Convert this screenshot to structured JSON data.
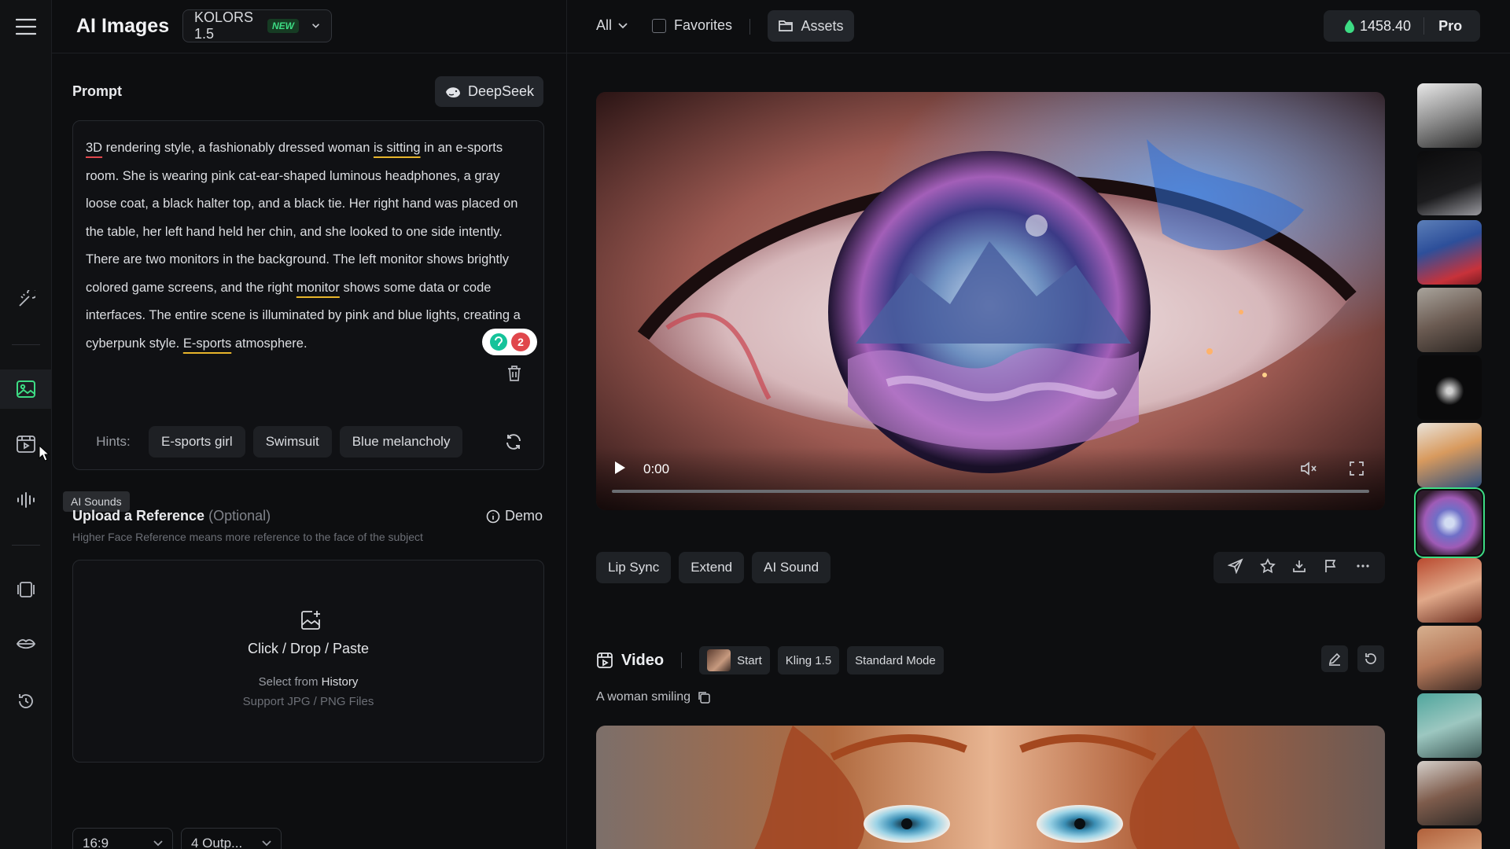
{
  "app": {
    "title": "AI Images",
    "model": "KOLORS 1.5",
    "model_badge": "NEW"
  },
  "sidebar": {
    "tooltip_sounds": "AI Sounds",
    "tooltip_videos_ghost": "AI Videos"
  },
  "topbar": {
    "filter": "All",
    "favorites": "Favorites",
    "assets": "Assets",
    "credits": "1458.40",
    "plan": "Pro"
  },
  "prompt": {
    "label": "Prompt",
    "deepseek": "DeepSeek",
    "text_parts": {
      "p1": "3D",
      "p2": " rendering style, a fashionably dressed woman ",
      "p3": "is sitting",
      "p4": " in an e-sports room. She is wearing pink cat-ear-shaped luminous headphones, a gray loose coat, a black halter top, and a black tie. Her right hand was placed on the table, her left hand held her chin, and she looked to one side intently. There are two monitors in the background. The left monitor shows brightly colored game screens, and the right ",
      "p5": "monitor",
      "p6": " shows some data or code interfaces. The entire scene is illuminated by pink and blue lights, creating a cyberpunk style. ",
      "p7": "E-sports",
      "p8": " atmosphere."
    },
    "grammar_count": "2",
    "hints_label": "Hints:",
    "hints": [
      "E-sports girl",
      "Swimsuit",
      "Blue melancholy"
    ]
  },
  "reference": {
    "title": "Upload a Reference",
    "optional": "(Optional)",
    "demo": "Demo",
    "subtitle": "Higher Face Reference means more reference to the face of the subject",
    "upload_title": "Click / Drop / Paste",
    "select_from": "Select from",
    "history": "History",
    "support": "Support JPG / PNG Files"
  },
  "settings": {
    "ratio": "16:9",
    "outputs": "4 Outp..."
  },
  "player": {
    "time": "0:00",
    "progress": 0
  },
  "actions": [
    "Lip Sync",
    "Extend",
    "AI Sound"
  ],
  "video_task": {
    "label": "Video",
    "start": "Start",
    "model": "Kling 1.5",
    "mode": "Standard Mode",
    "caption": "A woman smiling"
  },
  "colors": {
    "accent": "#3ddc84",
    "background": "#0d0e10",
    "panel": "#111214"
  }
}
